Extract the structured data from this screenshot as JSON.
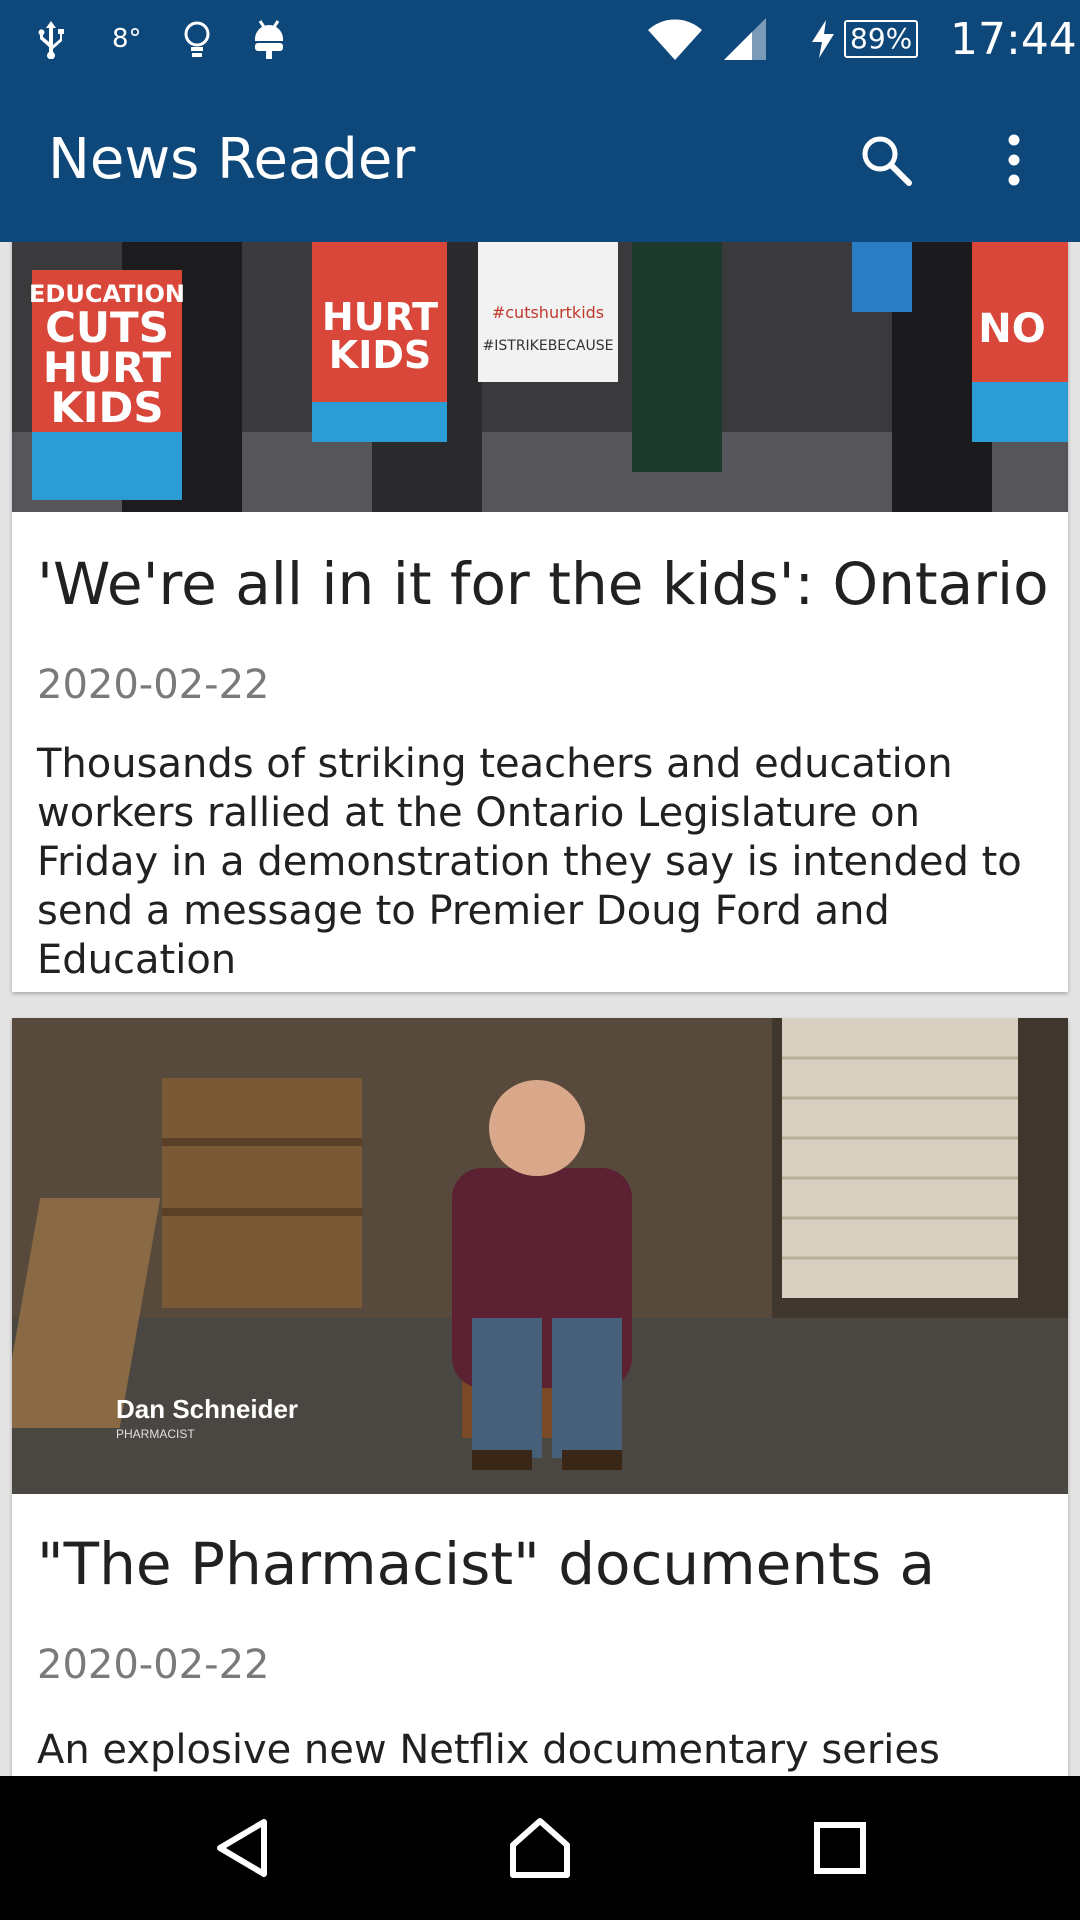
{
  "status_bar": {
    "icons": [
      "usb-icon",
      "weather-icon",
      "lightbulb-icon",
      "android-icon",
      "wifi-icon",
      "signal-icon",
      "charging-icon"
    ],
    "temperature": "8°",
    "battery": "89%",
    "time": "17:44"
  },
  "app_bar": {
    "title": "News Reader",
    "search_icon": "search-icon",
    "menu_icon": "more-vert-icon"
  },
  "articles": [
    {
      "title": "'We're all in it for the kids': Ontario",
      "date": "2020-02-22",
      "summary": "Thousands of striking teachers and education workers rallied at the Ontario Legislature on Friday in a demonstration they say is intended to send a message to Premier Doug Ford and Education",
      "image_signs": {
        "sign1": [
          "EDUCATION",
          "CUTS",
          "HURT",
          "KIDS"
        ],
        "sign2": [
          "HURT",
          "KIDS"
        ],
        "placard": "#cutshurtkids",
        "placard2": "#ISTRIKEBECAUSE",
        "sign3": "NO"
      }
    },
    {
      "title": "\"The Pharmacist\" documents a",
      "date": "2020-02-22",
      "summary": "An explosive new Netflix documentary series shows",
      "image_caption_name": "Dan Schneider",
      "image_caption_role": "PHARMACIST"
    }
  ],
  "nav_bar": {
    "back_icon": "back-icon",
    "home_icon": "home-icon",
    "recents_icon": "recents-icon"
  },
  "colors": {
    "primary": "#0e4779",
    "card_bg": "#ffffff",
    "feed_bg": "#e4e4e4",
    "title_text": "#212121",
    "date_text": "#7a7a7a"
  }
}
